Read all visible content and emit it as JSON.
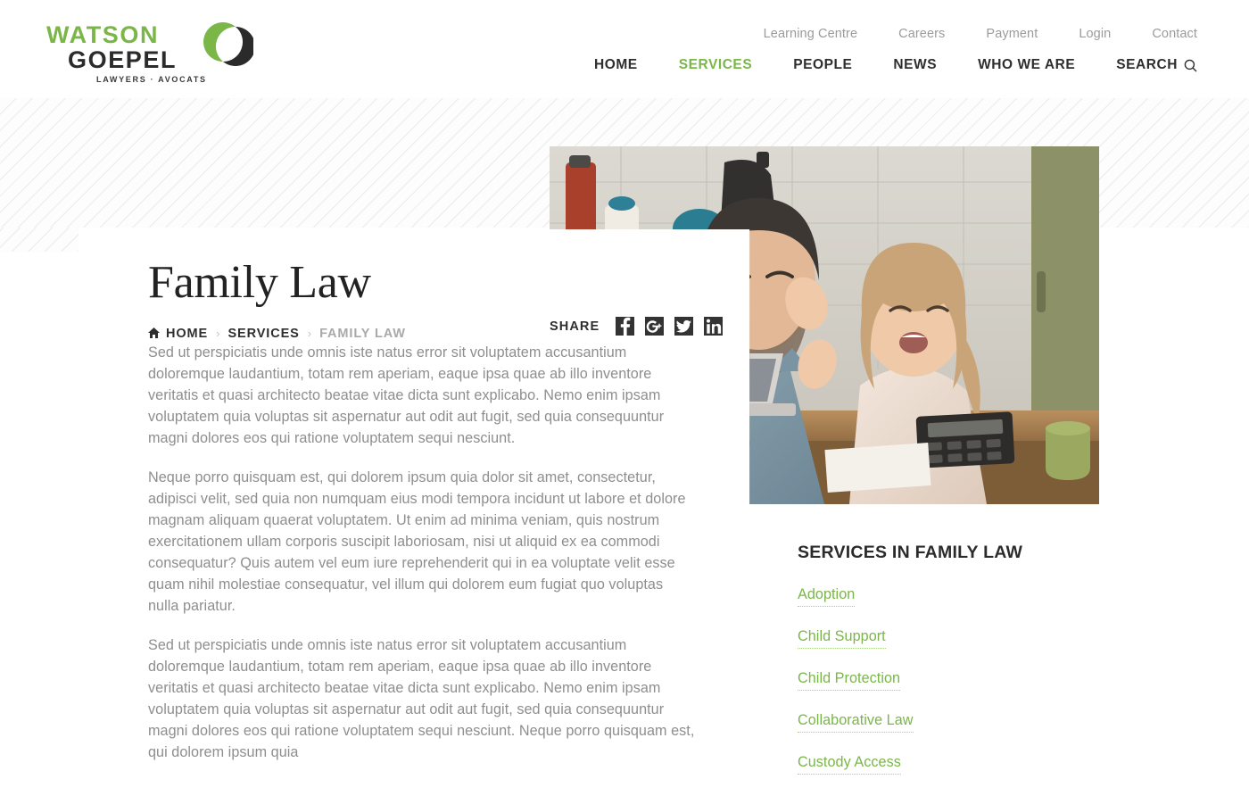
{
  "brand": {
    "name_line1": "WATSON",
    "name_line2": "GOEPEL",
    "tagline": "LAWYERS · AVOCATS",
    "accent_green": "#7ab648",
    "dark": "#2e2e2e"
  },
  "top_nav": [
    {
      "label": "Learning Centre"
    },
    {
      "label": "Careers"
    },
    {
      "label": "Payment"
    },
    {
      "label": "Login"
    },
    {
      "label": "Contact"
    }
  ],
  "main_nav": [
    {
      "label": "HOME",
      "active": false
    },
    {
      "label": "SERVICES",
      "active": true
    },
    {
      "label": "PEOPLE",
      "active": false
    },
    {
      "label": "NEWS",
      "active": false
    },
    {
      "label": "WHO WE ARE",
      "active": false
    },
    {
      "label": "SEARCH",
      "active": false,
      "icon": "search-icon"
    }
  ],
  "page": {
    "title": "Family Law"
  },
  "breadcrumb": {
    "home_icon": "home-icon",
    "items": [
      {
        "label": "HOME",
        "current": false
      },
      {
        "label": "SERVICES",
        "current": false
      },
      {
        "label": "FAMILY LAW",
        "current": true
      }
    ],
    "separator": "›"
  },
  "share": {
    "label": "SHARE",
    "buttons": [
      {
        "name": "facebook-icon",
        "label": "Facebook"
      },
      {
        "name": "google-plus-icon",
        "label": "Google Plus"
      },
      {
        "name": "twitter-icon",
        "label": "Twitter"
      },
      {
        "name": "linkedin-icon",
        "label": "LinkedIn"
      }
    ]
  },
  "article": {
    "paragraphs": [
      "Sed ut perspiciatis unde omnis iste natus error sit voluptatem accusantium doloremque laudantium, totam rem aperiam, eaque ipsa quae ab illo inventore veritatis et quasi architecto beatae vitae dicta sunt explicabo. Nemo enim ipsam voluptatem quia voluptas sit aspernatur aut odit aut fugit, sed quia consequuntur magni dolores eos qui ratione voluptatem sequi nesciunt.",
      "Neque porro quisquam est, qui dolorem ipsum quia dolor sit amet, consectetur, adipisci velit, sed quia non numquam eius modi tempora incidunt ut labore et dolore magnam aliquam quaerat voluptatem. Ut enim ad minima veniam, quis nostrum exercitationem ullam corporis suscipit laboriosam, nisi ut aliquid ex ea commodi consequatur? Quis autem vel eum iure reprehenderit qui in ea voluptate velit esse quam nihil molestiae consequatur, vel illum qui dolorem eum fugiat quo voluptas nulla pariatur.",
      "Sed ut perspiciatis unde omnis iste natus error sit voluptatem accusantium doloremque laudantium, totam rem aperiam, eaque ipsa quae ab illo inventore veritatis et quasi architecto beatae vitae dicta sunt explicabo. Nemo enim ipsam voluptatem quia voluptas sit aspernatur aut odit aut fugit, sed quia consequuntur magni dolores eos qui ratione voluptatem sequi nesciunt. Neque porro quisquam est, qui dolorem ipsum quia"
    ]
  },
  "sidebar": {
    "heading": "SERVICES IN FAMILY LAW",
    "links": [
      {
        "label": "Adoption"
      },
      {
        "label": "Child Support"
      },
      {
        "label": "Child Protection"
      },
      {
        "label": "Collaborative Law"
      },
      {
        "label": "Custody  Access"
      }
    ]
  },
  "hero_image": {
    "alt": "Father and young daughter at kitchen table with laptop and calculator"
  }
}
